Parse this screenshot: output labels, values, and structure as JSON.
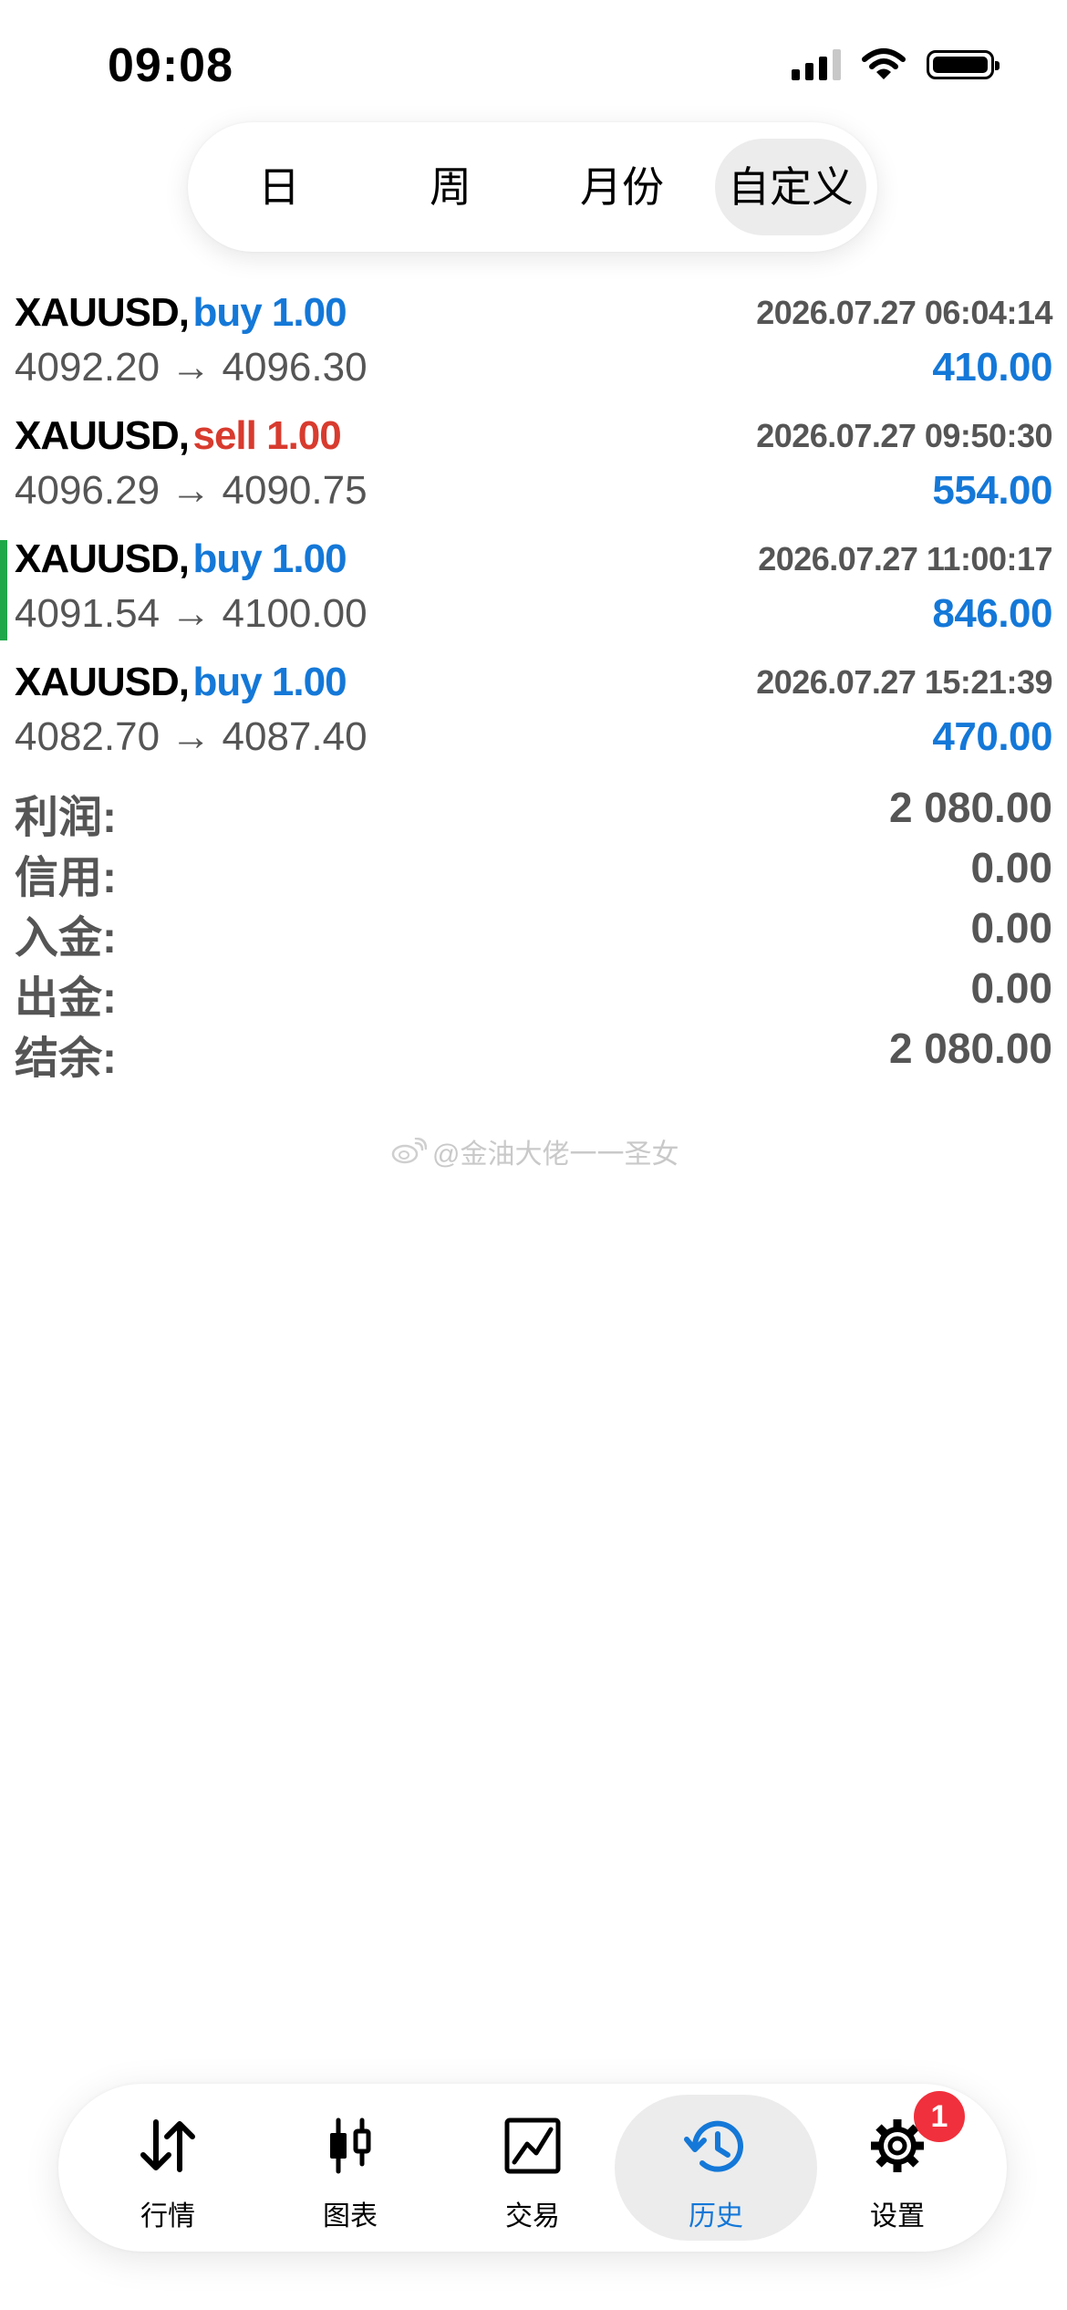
{
  "status_bar": {
    "time": "09:08"
  },
  "period_tabs": [
    {
      "label": "日"
    },
    {
      "label": "周"
    },
    {
      "label": "月份"
    },
    {
      "label": "自定义",
      "active": true
    }
  ],
  "trades": [
    {
      "symbol": "XAUUSD,",
      "direction": "buy 1.00",
      "side": "buy",
      "time": "2026.07.27 06:04:14",
      "prices": "4092.20 → 4096.30",
      "profit": "410.00"
    },
    {
      "symbol": "XAUUSD,",
      "direction": "sell 1.00",
      "side": "sell",
      "time": "2026.07.27 09:50:30",
      "prices": "4096.29 → 4090.75",
      "profit": "554.00"
    },
    {
      "symbol": "XAUUSD,",
      "direction": "buy 1.00",
      "side": "buy",
      "time": "2026.07.27 11:00:17",
      "prices": "4091.54 → 4100.00",
      "profit": "846.00",
      "highlighted": true
    },
    {
      "symbol": "XAUUSD,",
      "direction": "buy 1.00",
      "side": "buy",
      "time": "2026.07.27 15:21:39",
      "prices": "4082.70 → 4087.40",
      "profit": "470.00"
    }
  ],
  "summary": [
    {
      "label": "利润:",
      "value": "2 080.00"
    },
    {
      "label": "信用:",
      "value": "0.00"
    },
    {
      "label": "入金:",
      "value": "0.00"
    },
    {
      "label": "出金:",
      "value": "0.00"
    },
    {
      "label": "结余:",
      "value": "2 080.00"
    }
  ],
  "watermark": {
    "text": "@金油大佬一一圣女",
    "icon": "weibo-icon"
  },
  "bottom_tabs": [
    {
      "label": "行情",
      "icon": "quotes-arrows-icon"
    },
    {
      "label": "图表",
      "icon": "candlestick-chart-icon"
    },
    {
      "label": "交易",
      "icon": "trade-chart-icon"
    },
    {
      "label": "历史",
      "icon": "history-clock-icon",
      "active": true
    },
    {
      "label": "设置",
      "icon": "gear-icon",
      "badge": "1"
    }
  ],
  "colors": {
    "accent": "#1478d8",
    "sell": "#d83b2e",
    "highlight_bar": "#1fa84a",
    "badge": "#f0303c"
  }
}
